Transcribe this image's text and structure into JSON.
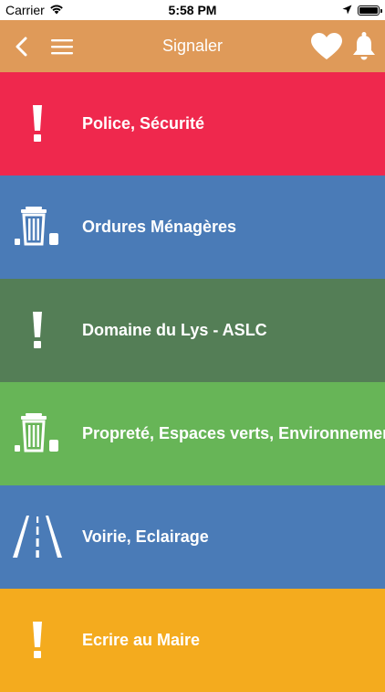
{
  "status_bar": {
    "carrier": "Carrier",
    "time": "5:58 PM"
  },
  "navbar": {
    "title": "Signaler",
    "bg_color": "#df9a59"
  },
  "categories": [
    {
      "label": "Police, Sécurité",
      "icon": "exclamation-icon",
      "color": "#ef284d"
    },
    {
      "label": "Ordures Ménagères",
      "icon": "trash-bin-icon",
      "color": "#4a7bb7"
    },
    {
      "label": "Domaine du Lys - ASLC",
      "icon": "exclamation-icon",
      "color": "#547e56"
    },
    {
      "label": "Propreté, Espaces verts, Environnement",
      "icon": "trash-bin-icon",
      "color": "#67b557"
    },
    {
      "label": "Voirie, Eclairage",
      "icon": "road-icon",
      "color": "#4a7bb7"
    },
    {
      "label": "Ecrire au Maire",
      "icon": "exclamation-icon",
      "color": "#f4ab1e"
    }
  ]
}
